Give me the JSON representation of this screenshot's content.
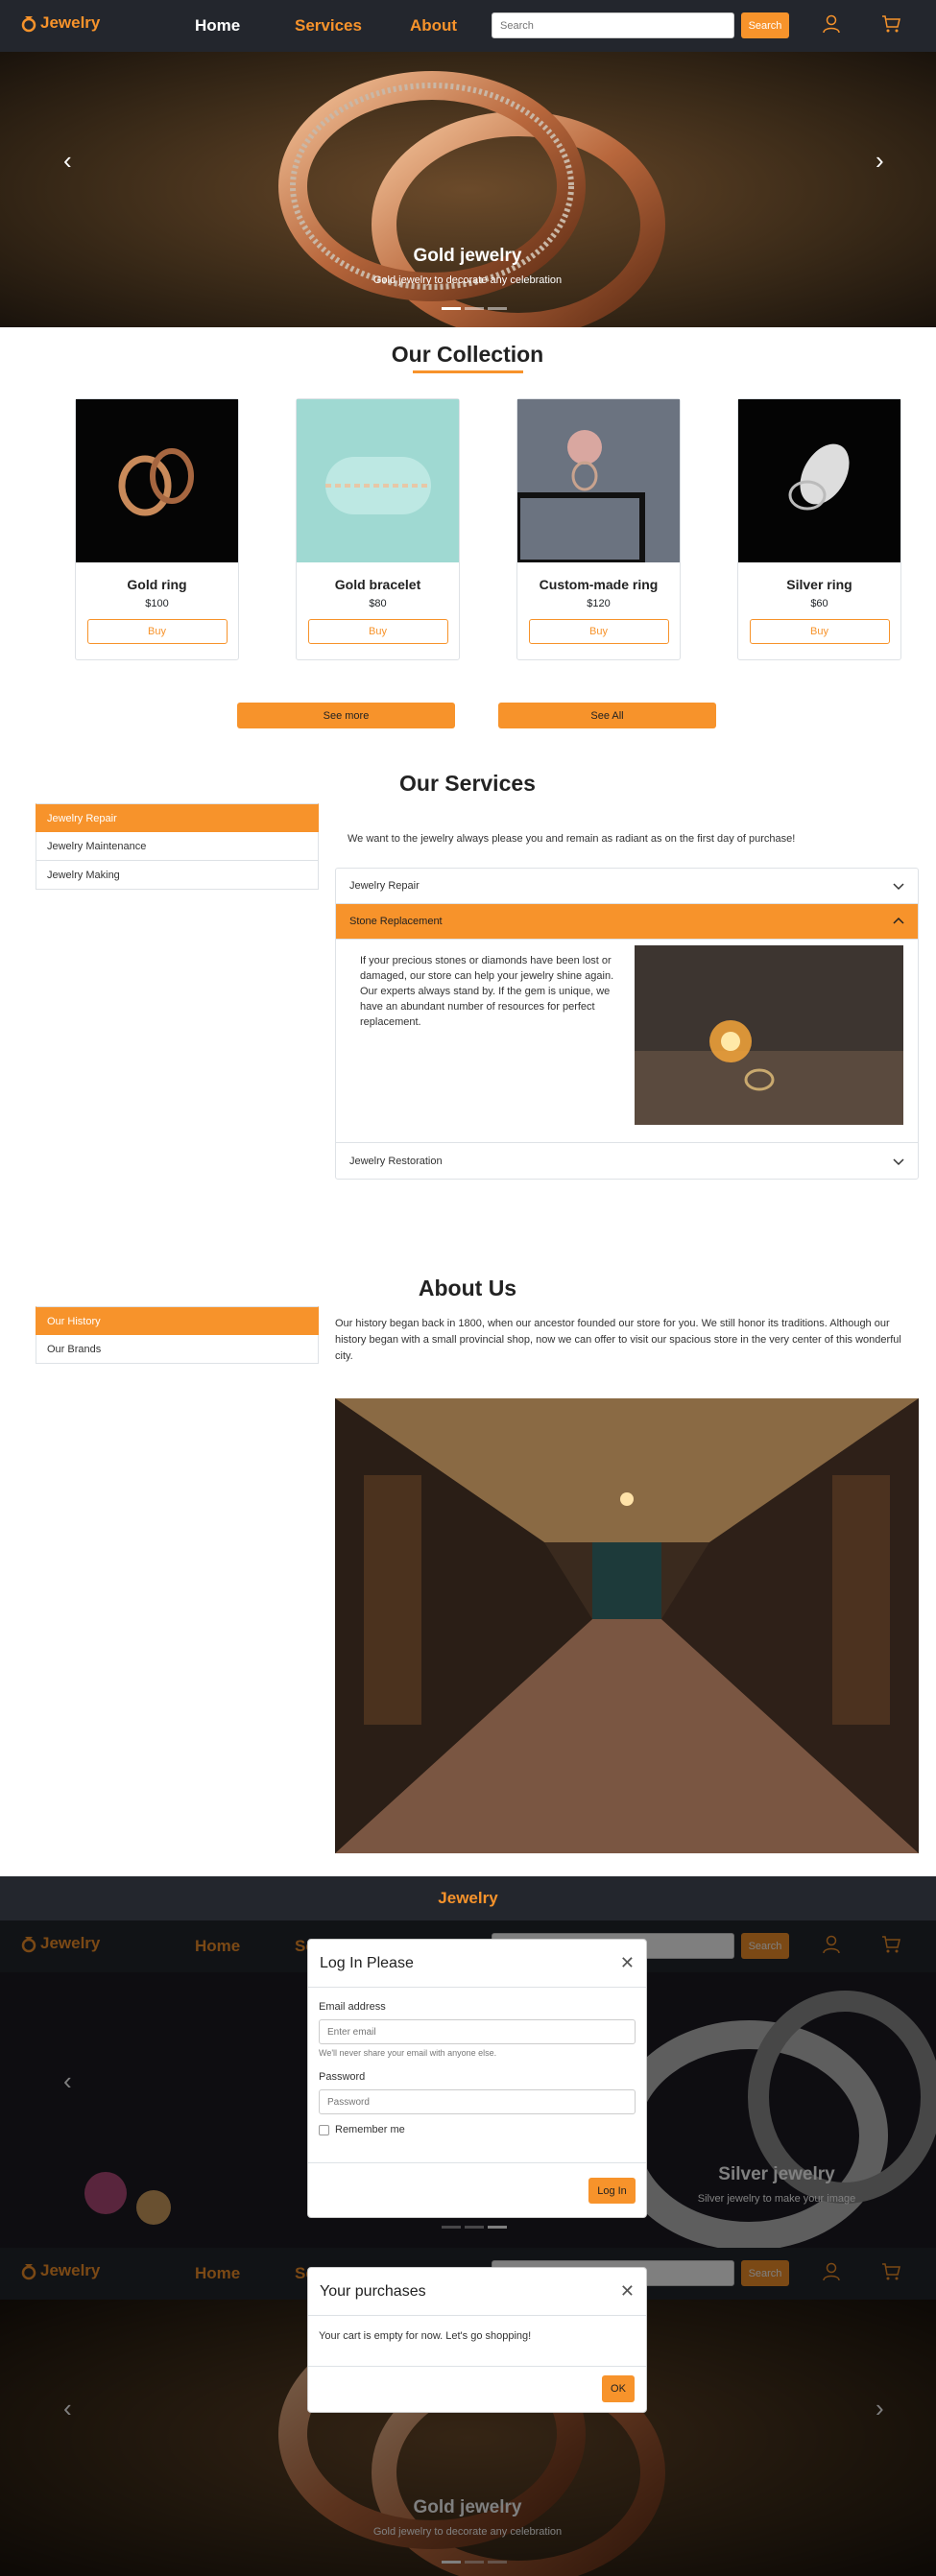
{
  "nav": {
    "brand": "Jewelry",
    "home": "Home",
    "services": "Services",
    "about": "About",
    "search_placeholder": "Search",
    "search_button": "Search"
  },
  "hero": {
    "slide1_title": "Gold jewelry",
    "slide1_subtitle": "Gold jewelry to decorate any celebration",
    "slide3_title": "Silver jewelry",
    "slide3_subtitle": "Silver jewelry to make your image"
  },
  "collection": {
    "title": "Our Collection",
    "items": [
      {
        "name": "Gold ring",
        "price": "$100",
        "buy": "Buy"
      },
      {
        "name": "Gold bracelet",
        "price": "$80",
        "buy": "Buy"
      },
      {
        "name": "Custom-made ring",
        "price": "$120",
        "buy": "Buy"
      },
      {
        "name": "Silver ring",
        "price": "$60",
        "buy": "Buy"
      }
    ],
    "see_more": "See more",
    "see_all": "See All"
  },
  "services": {
    "title": "Our Services",
    "tabs": [
      "Jewelry Repair",
      "Jewelry Maintenance",
      "Jewelry Making"
    ],
    "intro": "We want to the jewelry always please you and remain as radiant as on the first day of purchase!",
    "accordion": [
      {
        "label": "Jewelry Repair"
      },
      {
        "label": "Stone Replacement",
        "body": "If your precious stones or diamonds have been lost or damaged, our store can help your jewelry shine again. Our experts always stand by. If the gem is unique, we have an abundant number of resources for perfect replacement."
      },
      {
        "label": "Jewelry Restoration"
      }
    ]
  },
  "about": {
    "title": "About Us",
    "tabs": [
      "Our History",
      "Our Brands"
    ],
    "text": "Our history began back in 1800, when our ancestor founded our store for you. We still honor its traditions. Although our history began with a small provincial shop, now we can offer to visit our spacious store in the very center of this wonderful city."
  },
  "footer": {
    "brand": "Jewelry"
  },
  "login_modal": {
    "title": "Log In Please",
    "email_label": "Email address",
    "email_placeholder": "Enter email",
    "email_help": "We'll never share your email with anyone else.",
    "password_label": "Password",
    "password_placeholder": "Password",
    "remember": "Remember me",
    "submit": "Log In"
  },
  "cart_modal": {
    "title": "Your purchases",
    "body": "Your cart is empty for now. Let's go shopping!",
    "ok": "OK"
  },
  "colors": {
    "accent": "#f7932b",
    "navbar": "#23262d"
  }
}
